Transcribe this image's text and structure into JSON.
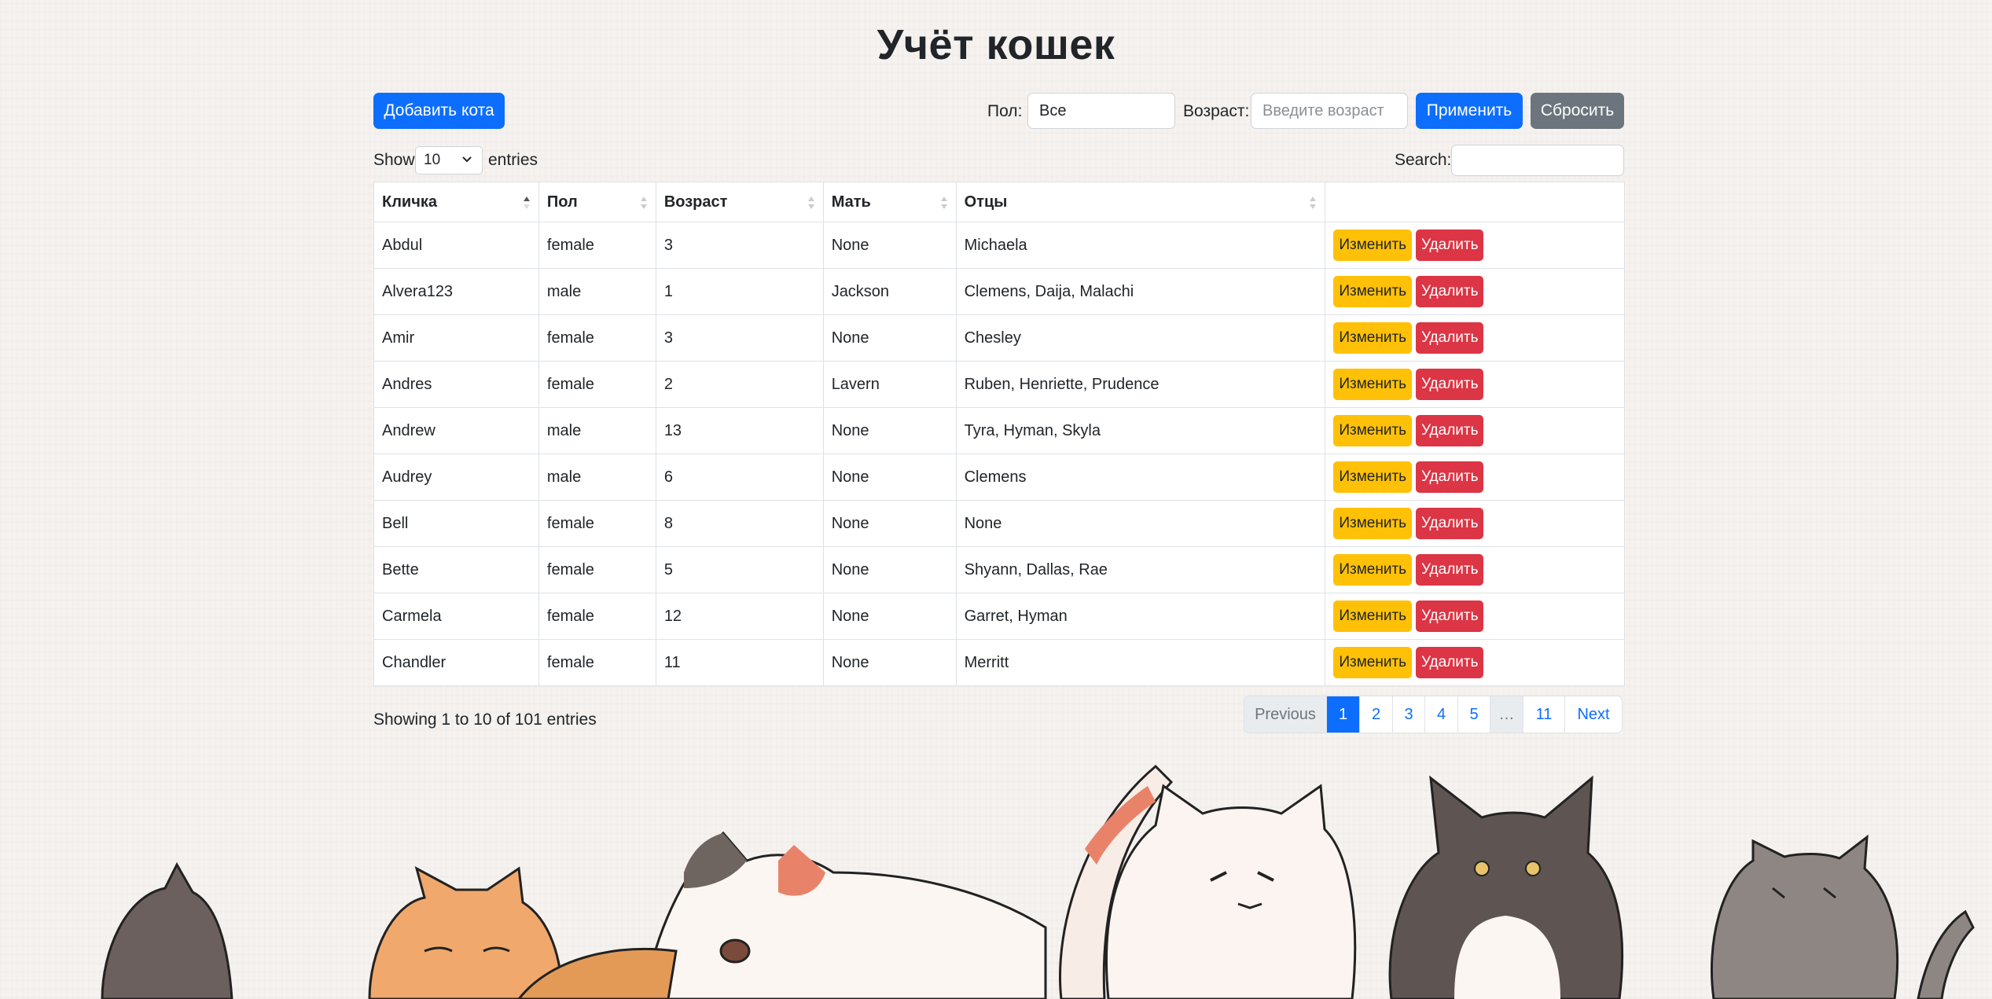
{
  "title": "Учёт кошек",
  "toolbar": {
    "add_label": "Добавить кота",
    "sex_label": "Пол:",
    "sex_value": "Все",
    "age_label": "Возраст:",
    "age_placeholder": "Введите возраст",
    "apply_label": "Применить",
    "reset_label": "Сбросить"
  },
  "table_controls": {
    "show_label": "Show",
    "length_value": "10",
    "entries_label": "entries",
    "search_label": "Search:"
  },
  "table": {
    "headers": [
      "Кличка",
      "Пол",
      "Возраст",
      "Мать",
      "Отцы",
      ""
    ],
    "edit_label": "Изменить",
    "delete_label": "Удалить",
    "rows": [
      [
        "Abdul",
        "female",
        "3",
        "None",
        "Michaela"
      ],
      [
        "Alvera123",
        "male",
        "1",
        "Jackson",
        "Clemens, Daija, Malachi"
      ],
      [
        "Amir",
        "female",
        "3",
        "None",
        "Chesley"
      ],
      [
        "Andres",
        "female",
        "2",
        "Lavern",
        "Ruben, Henriette, Prudence"
      ],
      [
        "Andrew",
        "male",
        "13",
        "None",
        "Tyra, Hyman, Skyla"
      ],
      [
        "Audrey",
        "male",
        "6",
        "None",
        "Clemens"
      ],
      [
        "Bell",
        "female",
        "8",
        "None",
        "None"
      ],
      [
        "Bette",
        "female",
        "5",
        "None",
        "Shyann, Dallas, Rae"
      ],
      [
        "Carmela",
        "female",
        "12",
        "None",
        "Garret, Hyman"
      ],
      [
        "Chandler",
        "female",
        "11",
        "None",
        "Merritt"
      ]
    ]
  },
  "info": "Showing 1 to 10 of 101 entries",
  "pagination": {
    "previous": "Previous",
    "pages": [
      "1",
      "2",
      "3",
      "4",
      "5",
      "…",
      "11"
    ],
    "next": "Next"
  },
  "colors": {
    "primary": "#0d6efd",
    "secondary": "#6c757d",
    "warning": "#ffc107",
    "danger": "#dc3545"
  },
  "icons": [
    "chevron-down-icon",
    "sort-icon"
  ]
}
